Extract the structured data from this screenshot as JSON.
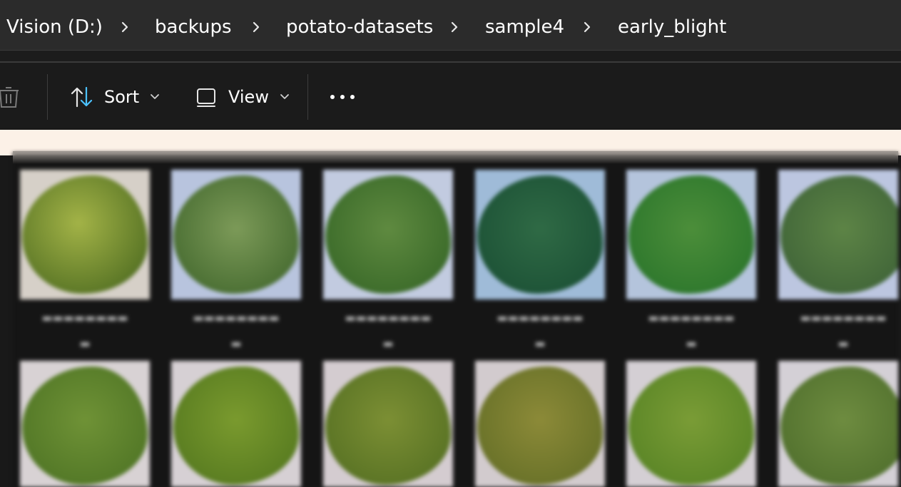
{
  "breadcrumb": {
    "items": [
      "Vision (D:)",
      "backups",
      "potato-datasets",
      "sample4",
      "early_blight"
    ]
  },
  "toolbar": {
    "sort_label": "Sort",
    "view_label": "View",
    "more_label": "•••"
  },
  "colors": {
    "accent": "#4cc2ff",
    "background": "#191919",
    "address_bar": "#2b2b2b",
    "cream_bar": "#fcf1e7"
  },
  "icons": {
    "delete": "trash-icon",
    "sort": "sort-arrows-icon",
    "view": "view-layout-icon",
    "more": "more-dots-icon",
    "chevron": "chevron-right-icon"
  }
}
